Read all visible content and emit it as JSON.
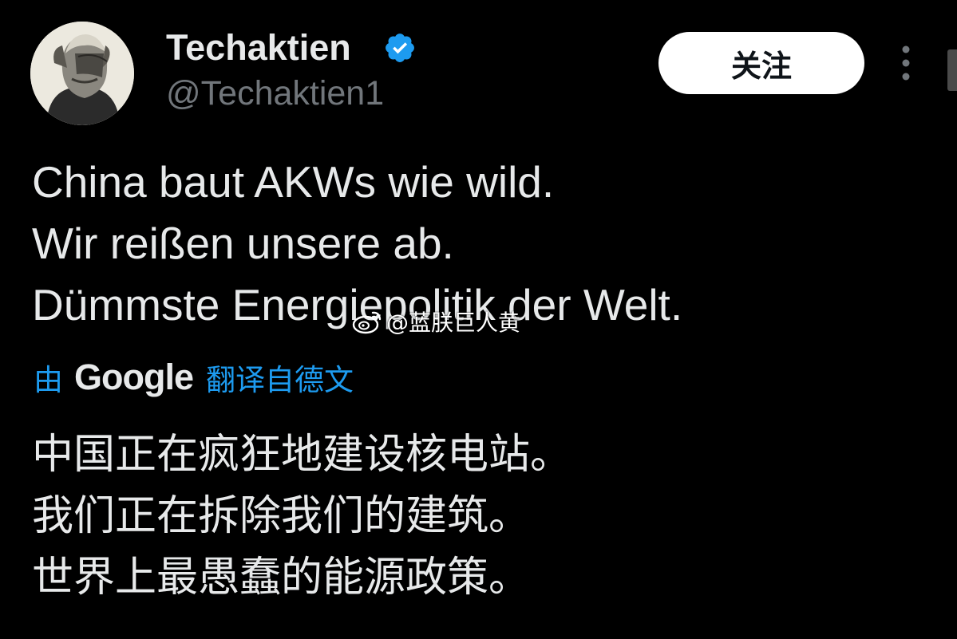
{
  "author": {
    "name": "Techaktien",
    "handle": "@Techaktien1",
    "verified": true,
    "verified_color": "#1d9bf0",
    "avatar": "portrait-avatar"
  },
  "actions": {
    "follow_label": "关注",
    "more_icon": "more-vertical-icon"
  },
  "tweet": {
    "lines": [
      "China baut AKWs wie wild.",
      "Wir reißen unsere ab.",
      "Dümmste Energiepolitik der Welt."
    ]
  },
  "translation": {
    "prefix": "由",
    "provider": "Google",
    "link_text": "翻译自德文",
    "lines": [
      "中国正在疯狂地建设核电站。",
      "我们正在拆除我们的建筑。",
      "世界上最愚蠢的能源政策。"
    ]
  },
  "watermark": {
    "text": "@蓝朕巨人黄",
    "icon": "weibo-logo-icon"
  },
  "colors": {
    "background": "#000000",
    "text": "#e7e9ea",
    "secondary": "#71767b",
    "accent": "#1d9bf0",
    "button_bg": "#ffffff"
  }
}
